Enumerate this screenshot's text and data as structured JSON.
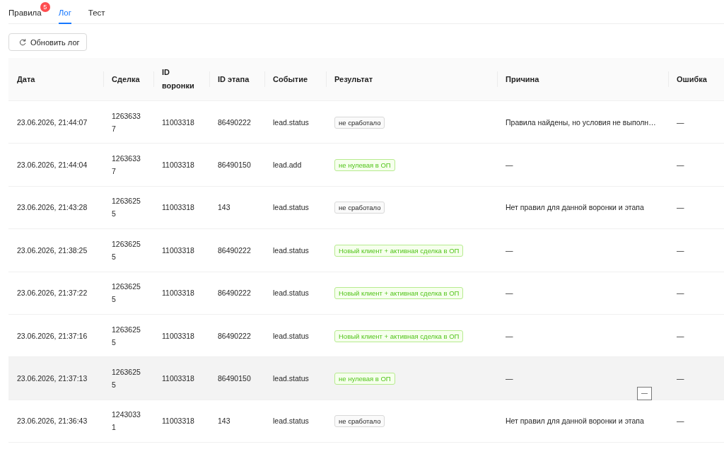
{
  "tabs": [
    {
      "label": "Правила",
      "selected": false,
      "badge": "5"
    },
    {
      "label": "Лог",
      "selected": true
    },
    {
      "label": "Тест",
      "selected": false
    }
  ],
  "refresh_button": {
    "label": "Обновить лог"
  },
  "table": {
    "columns": [
      "Дата",
      "Сделка",
      "ID воронки",
      "ID этапа",
      "Событие",
      "Результат",
      "Причина",
      "Ошибка"
    ],
    "rows": [
      {
        "date": "23.06.2026, 21:44:07",
        "deal": "12636337",
        "pipeline_id": "11003318",
        "stage_id": "86490222",
        "event": "lead.status",
        "result": {
          "text": "не сработало",
          "kind": "default"
        },
        "reason": "Правила найдены, но условия не выполн…",
        "error": "—",
        "highlighted": false
      },
      {
        "date": "23.06.2026, 21:44:04",
        "deal": "12636337",
        "pipeline_id": "11003318",
        "stage_id": "86490150",
        "event": "lead.add",
        "result": {
          "text": "не нулевая в ОП",
          "kind": "success"
        },
        "reason": "—",
        "error": "—",
        "highlighted": false
      },
      {
        "date": "23.06.2026, 21:43:28",
        "deal": "12636255",
        "pipeline_id": "11003318",
        "stage_id": "143",
        "event": "lead.status",
        "result": {
          "text": "не сработало",
          "kind": "default"
        },
        "reason": "Нет правил для данной воронки и этапа",
        "error": "—",
        "highlighted": false
      },
      {
        "date": "23.06.2026, 21:38:25",
        "deal": "12636255",
        "pipeline_id": "11003318",
        "stage_id": "86490222",
        "event": "lead.status",
        "result": {
          "text": "Новый клиент + активная сделка в ОП",
          "kind": "success"
        },
        "reason": "—",
        "error": "—",
        "highlighted": false
      },
      {
        "date": "23.06.2026, 21:37:22",
        "deal": "12636255",
        "pipeline_id": "11003318",
        "stage_id": "86490222",
        "event": "lead.status",
        "result": {
          "text": "Новый клиент + активная сделка в ОП",
          "kind": "success"
        },
        "reason": "—",
        "error": "—",
        "highlighted": false
      },
      {
        "date": "23.06.2026, 21:37:16",
        "deal": "12636255",
        "pipeline_id": "11003318",
        "stage_id": "86490222",
        "event": "lead.status",
        "result": {
          "text": "Новый клиент + активная сделка в ОП",
          "kind": "success"
        },
        "reason": "—",
        "error": "—",
        "highlighted": false
      },
      {
        "date": "23.06.2026, 21:37:13",
        "deal": "12636255",
        "pipeline_id": "11003318",
        "stage_id": "86490150",
        "event": "lead.status",
        "result": {
          "text": "не нулевая в ОП",
          "kind": "success"
        },
        "reason": "—",
        "error": "—",
        "highlighted": true,
        "tooltip": "—"
      },
      {
        "date": "23.06.2026, 21:36:43",
        "deal": "12430331",
        "pipeline_id": "11003318",
        "stage_id": "143",
        "event": "lead.status",
        "result": {
          "text": "не сработало",
          "kind": "default"
        },
        "reason": "Нет правил для данной воронки и этапа",
        "error": "—",
        "highlighted": false
      }
    ]
  }
}
